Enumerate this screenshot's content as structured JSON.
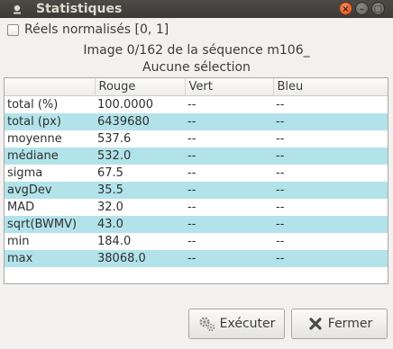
{
  "window": {
    "title": "Statistiques",
    "buttons": {
      "close": "×",
      "minimize": "–",
      "maximize": "□"
    }
  },
  "options": {
    "normalized_label": "Réels normalisés [0, 1]",
    "normalized_checked": false
  },
  "info": {
    "image_line": "Image 0/162 de la séquence m106_",
    "selection_line": "Aucune sélection"
  },
  "table": {
    "headers": [
      "",
      "Rouge",
      "Vert",
      "Bleu"
    ],
    "rows": [
      [
        "total (%)",
        "100.0000",
        "--",
        "--"
      ],
      [
        "total (px)",
        "6439680",
        "--",
        "--"
      ],
      [
        "moyenne",
        "537.6",
        "--",
        "--"
      ],
      [
        "médiane",
        "532.0",
        "--",
        "--"
      ],
      [
        "sigma",
        "67.5",
        "--",
        "--"
      ],
      [
        "avgDev",
        "35.5",
        "--",
        "--"
      ],
      [
        "MAD",
        "32.0",
        "--",
        "--"
      ],
      [
        "sqrt(BWMV)",
        "43.0",
        "--",
        "--"
      ],
      [
        "min",
        "184.0",
        "--",
        "--"
      ],
      [
        "max",
        "38068.0",
        "--",
        "--"
      ]
    ]
  },
  "buttons": {
    "execute": "Exécuter",
    "close": "Fermer"
  },
  "icons": {
    "app": "siril-app-icon",
    "execute": "gears-icon",
    "close": "x-icon"
  },
  "colors": {
    "row_alt": "#b3e3ea",
    "titlebar": "#3b3a36"
  }
}
